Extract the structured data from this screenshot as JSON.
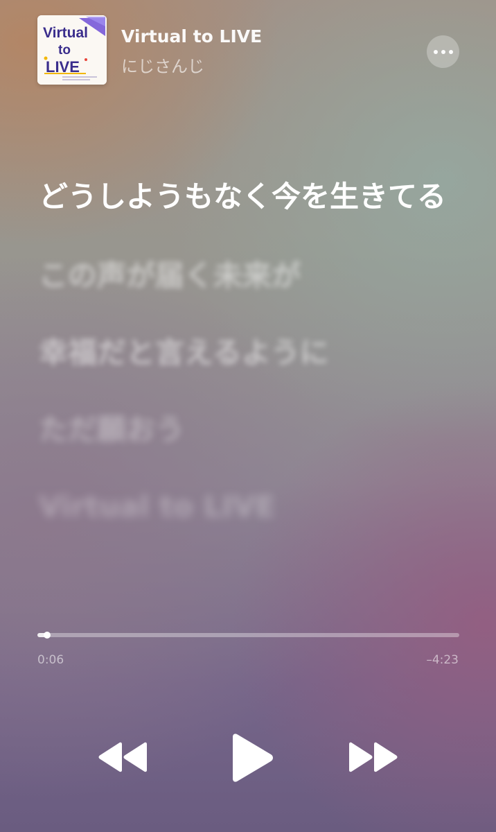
{
  "now_playing": {
    "title": "Virtual to LIVE",
    "artist": "にじさんじ",
    "artwork": {
      "text_line1": "Virtual",
      "text_line2": "to",
      "text_line3": "LIVE"
    }
  },
  "lyrics": {
    "current": "どうしようもなく今を生きてる",
    "upcoming": [
      "この声が届く未来が",
      "幸福だと言えるように",
      "ただ願おう",
      "Virtual to LIVE"
    ]
  },
  "playback": {
    "elapsed": "0:06",
    "remaining": "–4:23",
    "progress_fraction": 0.023
  },
  "icons": {
    "more": "ellipsis-icon",
    "rewind": "backward-icon",
    "play": "play-icon",
    "forward": "forward-icon"
  },
  "colors": {
    "text_primary": "#ffffff",
    "text_secondary": "rgba(255,255,255,0.62)"
  }
}
